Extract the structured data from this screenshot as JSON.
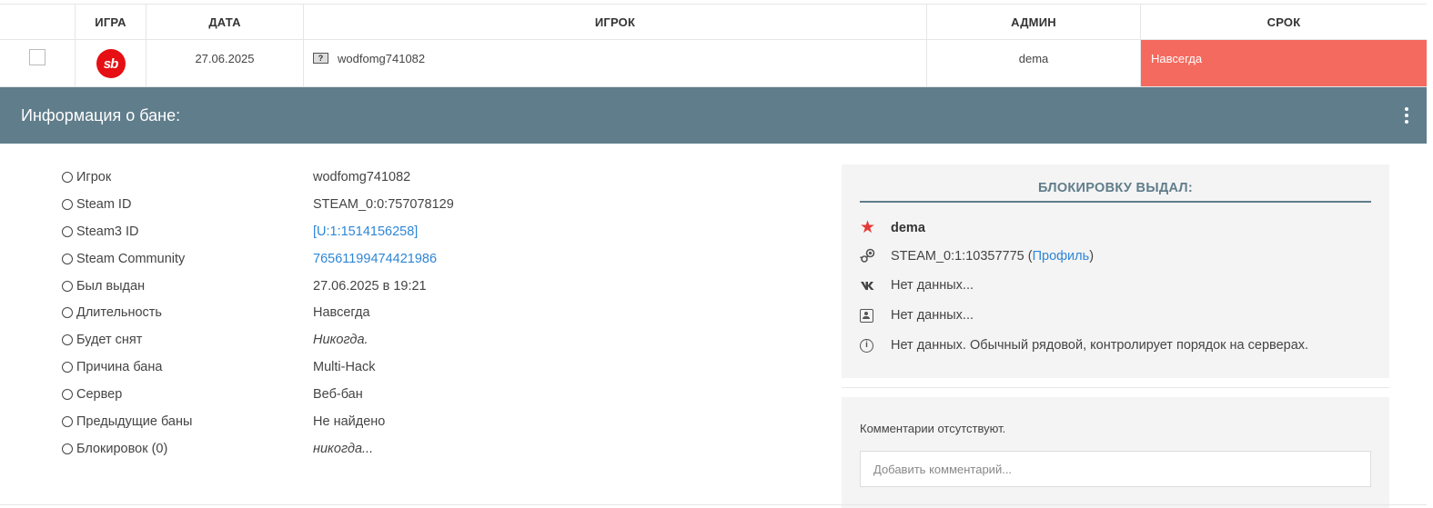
{
  "table": {
    "headers": {
      "game": "ИГРА",
      "date": "ДАТА",
      "player": "ИГРОК",
      "admin": "АДМИН",
      "term": "СРОК"
    },
    "row": {
      "game_logo_text": "sb",
      "date": "27.06.2025",
      "flag_icon": "?",
      "player": "wodfomg741082",
      "admin": "dema",
      "term": "Навсегда",
      "term_color": "#f56a5e"
    }
  },
  "infobar": {
    "title": "Информация о бане:",
    "color": "#607d8b"
  },
  "details": [
    {
      "label": "Игрок",
      "value": "wodfomg741082",
      "style": "plain"
    },
    {
      "label": "Steam ID",
      "value": "STEAM_0:0:757078129",
      "style": "plain"
    },
    {
      "label": "Steam3 ID",
      "value": "[U:1:1514156258]",
      "style": "link"
    },
    {
      "label": "Steam Community",
      "value": "76561199474421986",
      "style": "link"
    },
    {
      "label": "Был выдан",
      "value": "27.06.2025 в 19:21",
      "style": "plain"
    },
    {
      "label": "Длительность",
      "value": "Навсегда",
      "style": "plain"
    },
    {
      "label": "Будет снят",
      "value": "Никогда.",
      "style": "ital"
    },
    {
      "label": "Причина бана",
      "value": "Multi-Hack",
      "style": "plain"
    },
    {
      "label": "Сервер",
      "value": "Веб-бан",
      "style": "plain"
    },
    {
      "label": "Предыдущие баны",
      "value": "Не найдено",
      "style": "plain"
    },
    {
      "label": "Блокировок (0)",
      "value": "никогда...",
      "style": "ital"
    }
  ],
  "admin_card": {
    "title": "БЛОКИРОВКУ ВЫДАЛ:",
    "name": "dema",
    "steam_id": "STEAM_0:1:10357775",
    "paren_open": " (",
    "profile_link": "Профиль",
    "paren_close": ")",
    "vk": "Нет данных...",
    "contact": "Нет данных...",
    "info": "Нет данных. Обычный рядовой, контролирует порядок на серверах.",
    "icons": [
      "star-icon",
      "steam-icon",
      "vk-icon",
      "contact-icon",
      "info-icon"
    ]
  },
  "comments": {
    "empty_text": "Комментарии отсутствуют.",
    "placeholder": "Добавить комментарий..."
  }
}
